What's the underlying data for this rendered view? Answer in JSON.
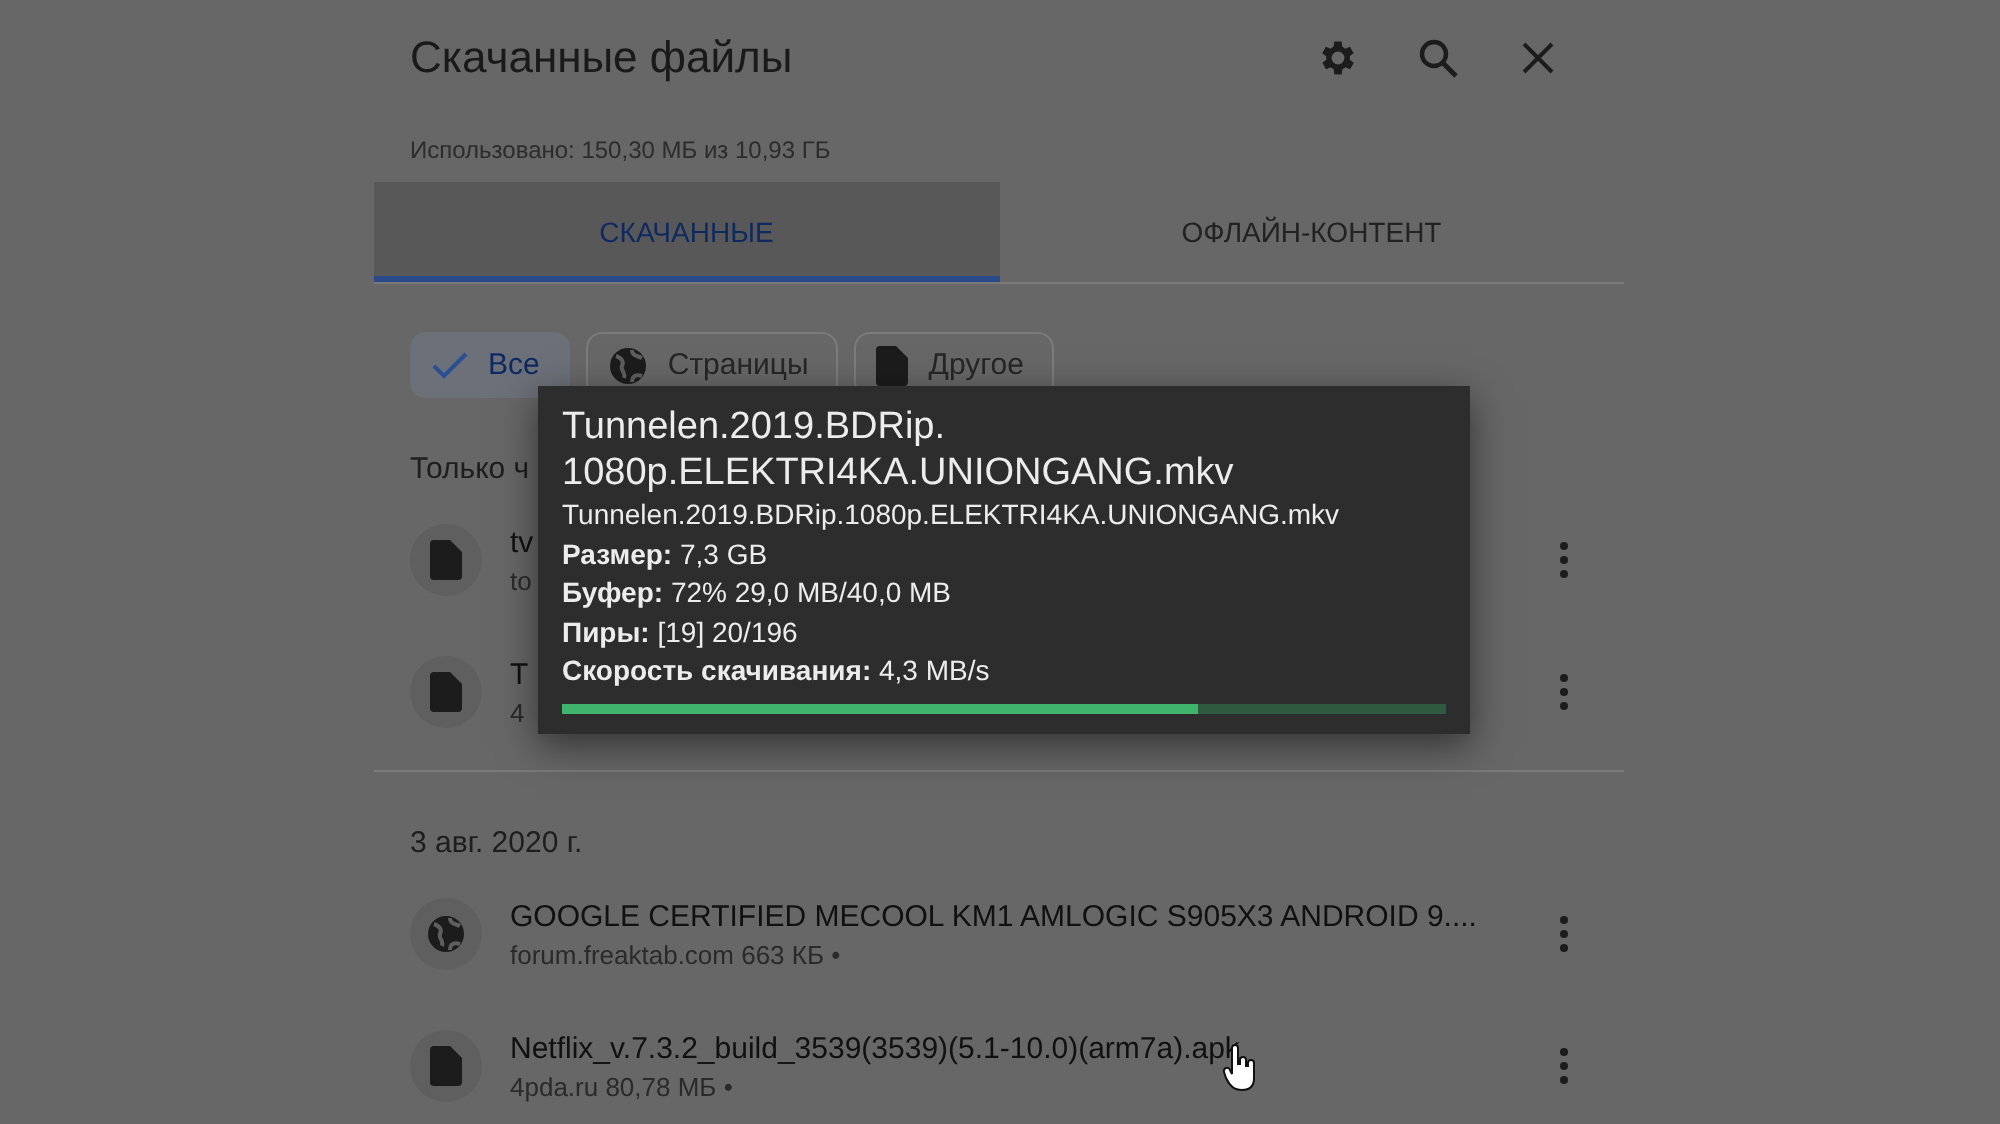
{
  "header": {
    "title": "Скачанные файлы",
    "usage": "Использовано: 150,30 МБ из 10,93 ГБ"
  },
  "tabs": [
    {
      "label": "СКАЧАННЫЕ",
      "selected": true
    },
    {
      "label": "ОФЛАЙН-КОНТЕНТ",
      "selected": false
    }
  ],
  "filters": [
    {
      "label": "Все",
      "kind": "all",
      "selected": true
    },
    {
      "label": "Страницы",
      "kind": "pages",
      "selected": false
    },
    {
      "label": "Другое",
      "kind": "other",
      "selected": false
    }
  ],
  "sections": [
    {
      "heading": "Только ч",
      "items": [
        {
          "kind": "file",
          "name": "tv",
          "meta": "to"
        },
        {
          "kind": "file",
          "name": "T",
          "meta": "4"
        }
      ]
    },
    {
      "heading": "3 авг. 2020 г.",
      "items": [
        {
          "kind": "page",
          "name": "GOOGLE CERTIFIED MECOOL KM1 AMLOGIC S905X3 ANDROID 9....",
          "meta": "forum.freaktab.com 663 КБ •"
        },
        {
          "kind": "file",
          "name": "Netflix_v.7.3.2_build_3539(3539)(5.1-10.0)(arm7a).apk",
          "meta": "4pda.ru 80,78 МБ •"
        }
      ]
    }
  ],
  "tooltip": {
    "title": "Tunnelen.2019.BDRip.\n1080p.ELEKTRI4KA.UNIONGANG.mkv",
    "file": "Tunnelen.2019.BDRip.1080p.ELEKTRI4KA.UNIONGANG.mkv",
    "lines": [
      {
        "label": "Размер:",
        "value": "7,3 GB"
      },
      {
        "label": "Буфер:",
        "value": "72% 29,0 MB/40,0 MB"
      },
      {
        "label": "Пиры:",
        "value": "[19] 20/196"
      },
      {
        "label": "Скорость скачивания:",
        "value": "4,3 MB/s"
      }
    ],
    "progress": {
      "level": 0.72
    }
  }
}
